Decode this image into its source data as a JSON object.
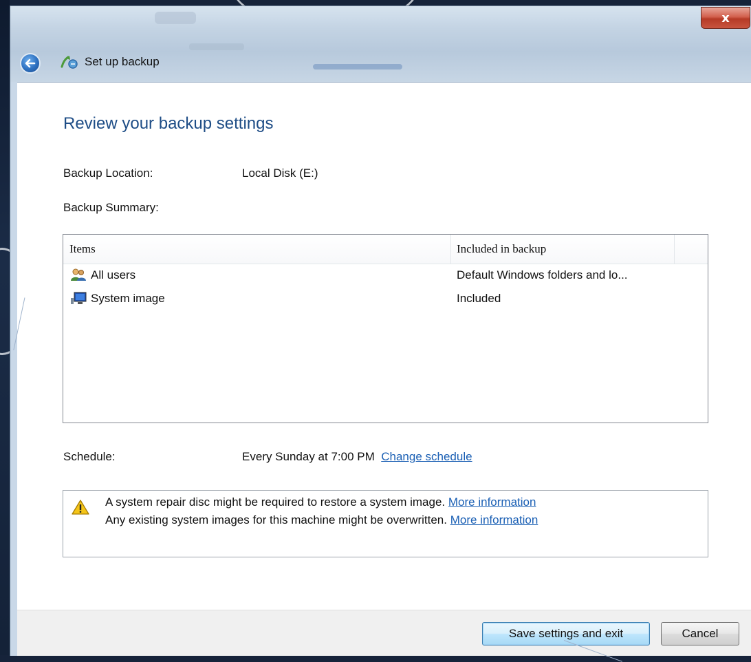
{
  "window": {
    "title": "Set up backup",
    "close_label": "x"
  },
  "page": {
    "heading": "Review your backup settings",
    "backup_location_label": "Backup Location:",
    "backup_location_value": "Local Disk (E:)",
    "backup_summary_label": "Backup Summary:"
  },
  "summary_table": {
    "columns": [
      "Items",
      "Included in backup"
    ],
    "rows": [
      {
        "icon": "users-icon",
        "item": "All users",
        "included": "Default Windows folders and lo..."
      },
      {
        "icon": "computer-icon",
        "item": "System image",
        "included": "Included"
      }
    ]
  },
  "schedule": {
    "label": "Schedule:",
    "value": "Every Sunday at 7:00 PM",
    "change_link": "Change schedule"
  },
  "warning": {
    "icon": "warning-icon",
    "line1_text": "A system repair disc might be required to restore a system image.",
    "line1_link": "More information",
    "line2_text": "Any existing system images for this machine might be overwritten.",
    "line2_link": "More information"
  },
  "footer": {
    "save_label": "Save settings and exit",
    "cancel_label": "Cancel"
  },
  "colors": {
    "heading": "#1e4d86",
    "link": "#1a5fb4",
    "close_button": "#c8543f"
  }
}
